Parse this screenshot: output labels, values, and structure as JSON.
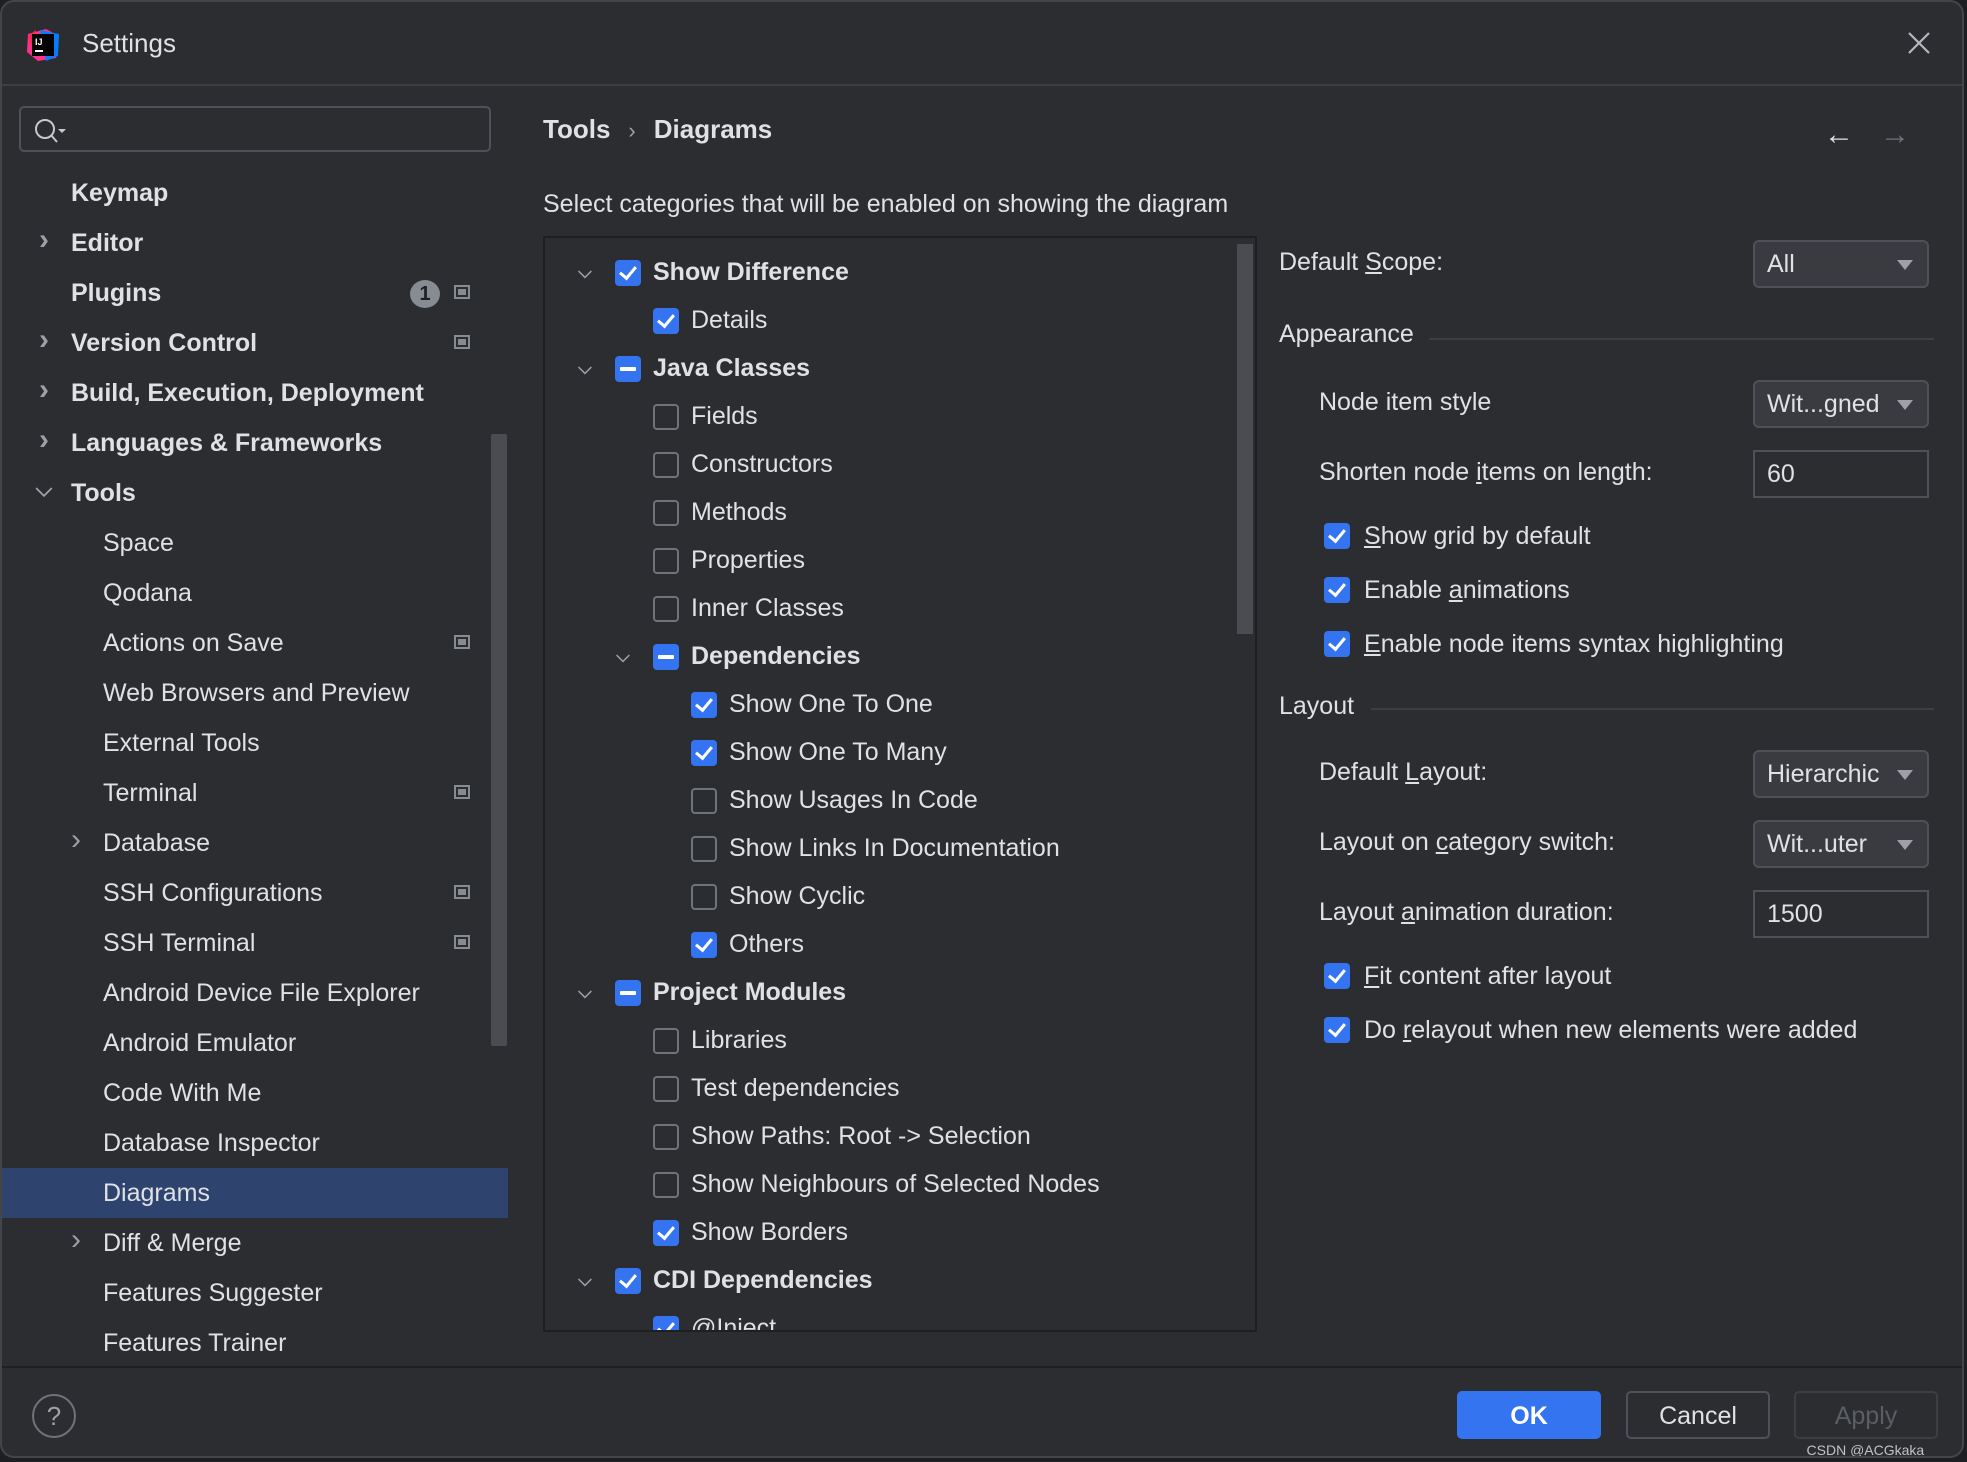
{
  "window": {
    "title": "Settings",
    "app_icon": "intellij-idea-logo"
  },
  "search": {
    "placeholder": "",
    "value": ""
  },
  "sidebar": {
    "items": [
      {
        "label": "Keymap",
        "level": 0,
        "bold": true,
        "expander": "none"
      },
      {
        "label": "Editor",
        "level": 0,
        "bold": true,
        "expander": "collapsed"
      },
      {
        "label": "Plugins",
        "level": 0,
        "bold": true,
        "expander": "none",
        "badge": "1",
        "project_icon": true
      },
      {
        "label": "Version Control",
        "level": 0,
        "bold": true,
        "expander": "collapsed",
        "project_icon": true
      },
      {
        "label": "Build, Execution, Deployment",
        "level": 0,
        "bold": true,
        "expander": "collapsed"
      },
      {
        "label": "Languages & Frameworks",
        "level": 0,
        "bold": true,
        "expander": "collapsed"
      },
      {
        "label": "Tools",
        "level": 0,
        "bold": true,
        "expander": "expanded"
      },
      {
        "label": "Space",
        "level": 1
      },
      {
        "label": "Qodana",
        "level": 1
      },
      {
        "label": "Actions on Save",
        "level": 1,
        "project_icon": true
      },
      {
        "label": "Web Browsers and Preview",
        "level": 1
      },
      {
        "label": "External Tools",
        "level": 1
      },
      {
        "label": "Terminal",
        "level": 1,
        "project_icon": true
      },
      {
        "label": "Database",
        "level": 1,
        "expander": "collapsed"
      },
      {
        "label": "SSH Configurations",
        "level": 1,
        "project_icon": true
      },
      {
        "label": "SSH Terminal",
        "level": 1,
        "project_icon": true
      },
      {
        "label": "Android Device File Explorer",
        "level": 1
      },
      {
        "label": "Android Emulator",
        "level": 1
      },
      {
        "label": "Code With Me",
        "level": 1
      },
      {
        "label": "Database Inspector",
        "level": 1
      },
      {
        "label": "Diagrams",
        "level": 1,
        "selected": true
      },
      {
        "label": "Diff & Merge",
        "level": 1,
        "expander": "collapsed"
      },
      {
        "label": "Features Suggester",
        "level": 1
      },
      {
        "label": "Features Trainer",
        "level": 1
      }
    ]
  },
  "breadcrumb": {
    "items": [
      "Tools",
      "Diagrams"
    ],
    "separator": "›"
  },
  "nav": {
    "back": "←",
    "forward": "→"
  },
  "description": "Select categories that will be enabled on showing the diagram",
  "categories": [
    {
      "label": "Show Difference",
      "level": 0,
      "state": "checked",
      "bold": true,
      "expander": true
    },
    {
      "label": "Details",
      "level": 1,
      "state": "checked"
    },
    {
      "label": "Java Classes",
      "level": 0,
      "state": "partial",
      "bold": true,
      "expander": true
    },
    {
      "label": "Fields",
      "level": 1,
      "state": "unchecked"
    },
    {
      "label": "Constructors",
      "level": 1,
      "state": "unchecked"
    },
    {
      "label": "Methods",
      "level": 1,
      "state": "unchecked"
    },
    {
      "label": "Properties",
      "level": 1,
      "state": "unchecked"
    },
    {
      "label": "Inner Classes",
      "level": 1,
      "state": "unchecked"
    },
    {
      "label": "Dependencies",
      "level": 1,
      "state": "partial",
      "bold": true,
      "expander": true
    },
    {
      "label": "Show One To One",
      "level": 2,
      "state": "checked"
    },
    {
      "label": "Show One To Many",
      "level": 2,
      "state": "checked"
    },
    {
      "label": "Show Usages In Code",
      "level": 2,
      "state": "unchecked"
    },
    {
      "label": "Show Links In Documentation",
      "level": 2,
      "state": "unchecked"
    },
    {
      "label": "Show Cyclic",
      "level": 2,
      "state": "unchecked"
    },
    {
      "label": "Others",
      "level": 2,
      "state": "checked"
    },
    {
      "label": "Project Modules",
      "level": 0,
      "state": "partial",
      "bold": true,
      "expander": true
    },
    {
      "label": "Libraries",
      "level": 1,
      "state": "unchecked"
    },
    {
      "label": "Test dependencies",
      "level": 1,
      "state": "unchecked"
    },
    {
      "label": "Show Paths: Root -> Selection",
      "level": 1,
      "state": "unchecked"
    },
    {
      "label": "Show Neighbours of Selected Nodes",
      "level": 1,
      "state": "unchecked"
    },
    {
      "label": "Show Borders",
      "level": 1,
      "state": "checked"
    },
    {
      "label": "CDI Dependencies",
      "level": 0,
      "state": "checked",
      "bold": true,
      "expander": true
    },
    {
      "label": "@Inject",
      "level": 1,
      "state": "checked"
    }
  ],
  "options": {
    "default_scope": {
      "label_pre": "Default ",
      "label_u": "S",
      "label_post": "cope:",
      "value": "All"
    },
    "appearance": {
      "title": "Appearance",
      "node_item_style": {
        "label": "Node item style",
        "value": "Wit...gned"
      },
      "shorten_length": {
        "label_pre": "Shorten node ",
        "label_u": "i",
        "label_post": "tems on length:",
        "value": "60"
      },
      "checkboxes": [
        {
          "pre": "",
          "u": "S",
          "post": "how grid by default",
          "checked": true
        },
        {
          "pre": "Enable ",
          "u": "a",
          "post": "nimations",
          "checked": true
        },
        {
          "pre": "",
          "u": "E",
          "post": "nable node items syntax highlighting",
          "checked": true
        }
      ]
    },
    "layout": {
      "title": "Layout",
      "default_layout": {
        "label_pre": "Default ",
        "label_u": "L",
        "label_post": "ayout:",
        "value": "Hierarchic"
      },
      "category_switch": {
        "label_pre": "Layout on ",
        "label_u": "c",
        "label_post": "ategory switch:",
        "value": "Wit...uter"
      },
      "animation_duration": {
        "label_pre": "Layout ",
        "label_u": "a",
        "label_post": "nimation duration:",
        "value": "1500"
      },
      "checkboxes": [
        {
          "pre": "",
          "u": "F",
          "post": "it content after layout",
          "checked": true
        },
        {
          "pre": "Do ",
          "u": "r",
          "post": "elayout when new elements were added",
          "checked": true
        }
      ]
    }
  },
  "footer": {
    "help": "?",
    "ok": "OK",
    "cancel": "Cancel",
    "apply": "Apply"
  },
  "watermark": "CSDN @ACGkaka_",
  "colors": {
    "accent": "#3574f0",
    "selection": "#2e436e",
    "background": "#2b2d30"
  }
}
